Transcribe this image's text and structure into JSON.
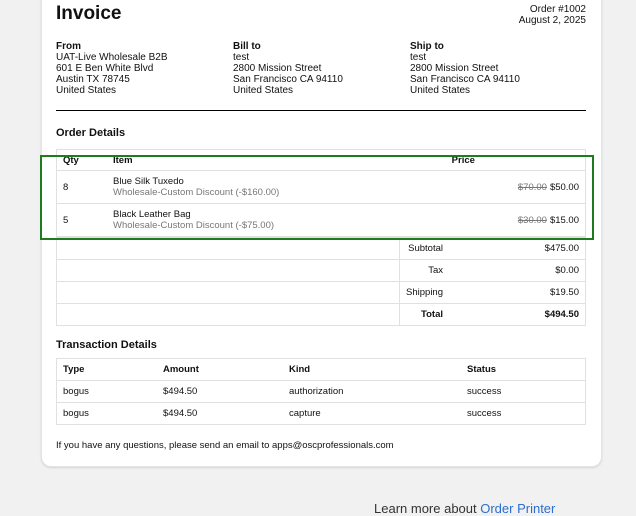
{
  "invoice": {
    "title": "Invoice",
    "order_number": "Order #1002",
    "date": "August 2, 2025"
  },
  "addresses": [
    {
      "heading": "From",
      "lines": [
        "UAT-Live Wholesale B2B",
        "601 E Ben White Blvd",
        "Austin TX 78745",
        "United States"
      ]
    },
    {
      "heading": "Bill to",
      "lines": [
        "test",
        "2800 Mission Street",
        "San Francisco CA 94110",
        "United States"
      ]
    },
    {
      "heading": "Ship to",
      "lines": [
        "test",
        "2800 Mission Street",
        "San Francisco CA 94110",
        "United States"
      ]
    }
  ],
  "order_details": {
    "title": "Order Details",
    "headers": {
      "qty": "Qty",
      "item": "Item",
      "price": "Price"
    },
    "items": [
      {
        "qty": "8",
        "name": "Blue Silk Tuxedo",
        "discount": "Wholesale-Custom Discount (-$160.00)",
        "original_price": "$70.00",
        "price": "$50.00"
      },
      {
        "qty": "5",
        "name": "Black Leather Bag",
        "discount": "Wholesale-Custom Discount (-$75.00)",
        "original_price": "$30.00",
        "price": "$15.00"
      }
    ],
    "totals": [
      {
        "label": "Subtotal",
        "value": "$475.00",
        "bold": false
      },
      {
        "label": "Tax",
        "value": "$0.00",
        "bold": false
      },
      {
        "label": "Shipping",
        "value": "$19.50",
        "bold": false
      },
      {
        "label": "Total",
        "value": "$494.50",
        "bold": true
      }
    ]
  },
  "transactions": {
    "title": "Transaction Details",
    "headers": {
      "type": "Type",
      "amount": "Amount",
      "kind": "Kind",
      "status": "Status"
    },
    "rows": [
      {
        "type": "bogus",
        "amount": "$494.50",
        "kind": "authorization",
        "status": "success"
      },
      {
        "type": "bogus",
        "amount": "$494.50",
        "kind": "capture",
        "status": "success"
      }
    ]
  },
  "footer_note": "If you have any questions, please send an email to apps@oscprofessionals.com",
  "learn_more": {
    "prefix": "Learn more about ",
    "link": "Order Printer"
  },
  "colors": {
    "highlight": "#1e7b1e",
    "link": "#2c6ecb"
  }
}
